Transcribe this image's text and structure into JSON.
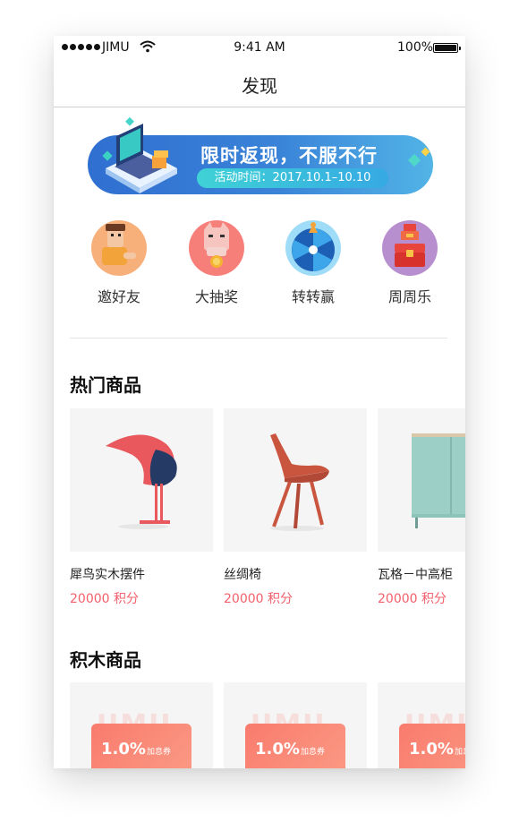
{
  "status_bar": {
    "carrier": "JIMU",
    "time": "9:41 AM",
    "battery": "100%"
  },
  "navbar": {
    "title": "发现"
  },
  "banner": {
    "title": "限时返现，不服不行",
    "subtitle": "活动时间：2017.10.1–10.10"
  },
  "categories": [
    {
      "label": "邀好友",
      "icon": "invite-friends-icon"
    },
    {
      "label": "大抽奖",
      "icon": "lucky-draw-icon"
    },
    {
      "label": "转转赢",
      "icon": "spin-wheel-icon"
    },
    {
      "label": "周周乐",
      "icon": "weekly-chest-icon"
    }
  ],
  "hot_products": {
    "title": "热门商品",
    "items": [
      {
        "name": "犀鸟实木摆件",
        "price": "20000 积分",
        "icon": "hornbill-ornament-image"
      },
      {
        "name": "丝绸椅",
        "price": "20000 积分",
        "icon": "silk-chair-image"
      },
      {
        "name": "瓦格－中高柜",
        "price": "20000 积分",
        "icon": "cabinet-image"
      }
    ]
  },
  "block_products": {
    "title": "积木商品",
    "watermark": "JIMU",
    "items": [
      {
        "rate": "1.0%",
        "tag": "加息券"
      },
      {
        "rate": "1.0%",
        "tag": "加息券"
      },
      {
        "rate": "1.0%",
        "tag": "加息券"
      }
    ]
  },
  "colors": {
    "accent_price": "#f2606b",
    "banner_blue": "#2f6fd0",
    "coupon": "#f97b6e"
  }
}
